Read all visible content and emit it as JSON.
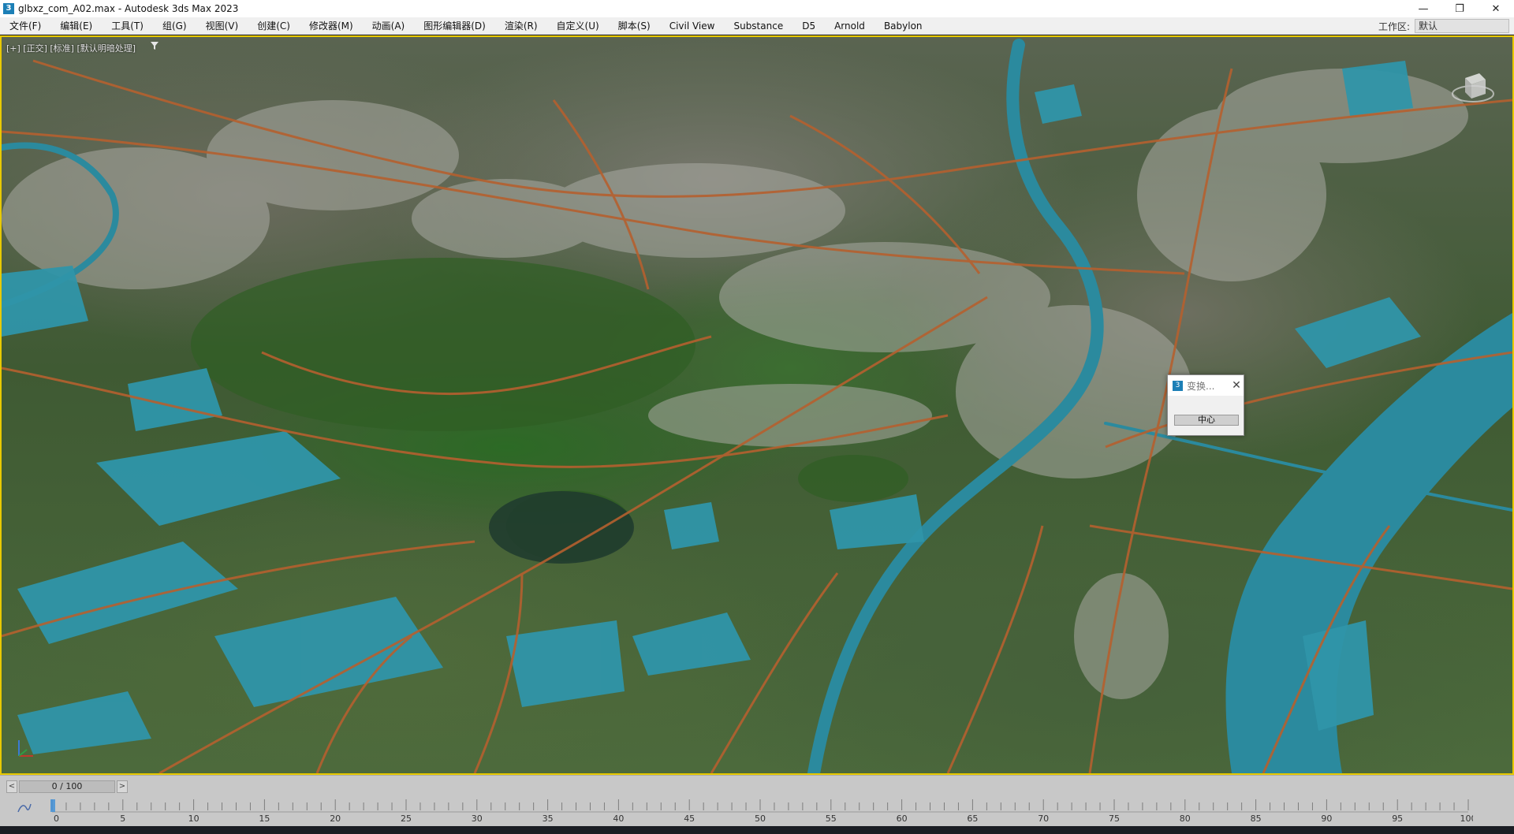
{
  "window": {
    "title": "glbxz_com_A02.max - Autodesk 3ds Max 2023",
    "app_icon_glyph": "3",
    "minimize_glyph": "—",
    "restore_glyph": "❐",
    "close_glyph": "✕"
  },
  "menu": {
    "items": [
      "文件(F)",
      "编辑(E)",
      "工具(T)",
      "组(G)",
      "视图(V)",
      "创建(C)",
      "修改器(M)",
      "动画(A)",
      "图形编辑器(D)",
      "渲染(R)",
      "自定义(U)",
      "脚本(S)",
      "Civil View",
      "Substance",
      "D5",
      "Arnold",
      "Babylon"
    ],
    "workspace_label": "工作区:",
    "workspace_value": "默认"
  },
  "viewport": {
    "label": "[+] [正交] [标准] [默认明暗处理]",
    "border_color": "#e8c900",
    "icons": [
      "filter-icon",
      "viewcube-icon",
      "axis-tripod-icon"
    ]
  },
  "dialog": {
    "icon_glyph": "3",
    "title": "变换...",
    "close_glyph": "✕",
    "button_label": "中心"
  },
  "timeline": {
    "frame_display": "0 / 100",
    "prev_glyph": "<",
    "next_glyph": ">",
    "current_frame": 0,
    "start": 0,
    "end": 100,
    "major_ticks": [
      0,
      5,
      10,
      15,
      20,
      25,
      30,
      35,
      40,
      45,
      50,
      55,
      60,
      65,
      70,
      75,
      80,
      85,
      90,
      95,
      100
    ]
  },
  "colors": {
    "road": "#b5602f",
    "water": "#2b8a9e",
    "vegetation": "#3d6a2e",
    "buildings": "#b9b9b5"
  }
}
